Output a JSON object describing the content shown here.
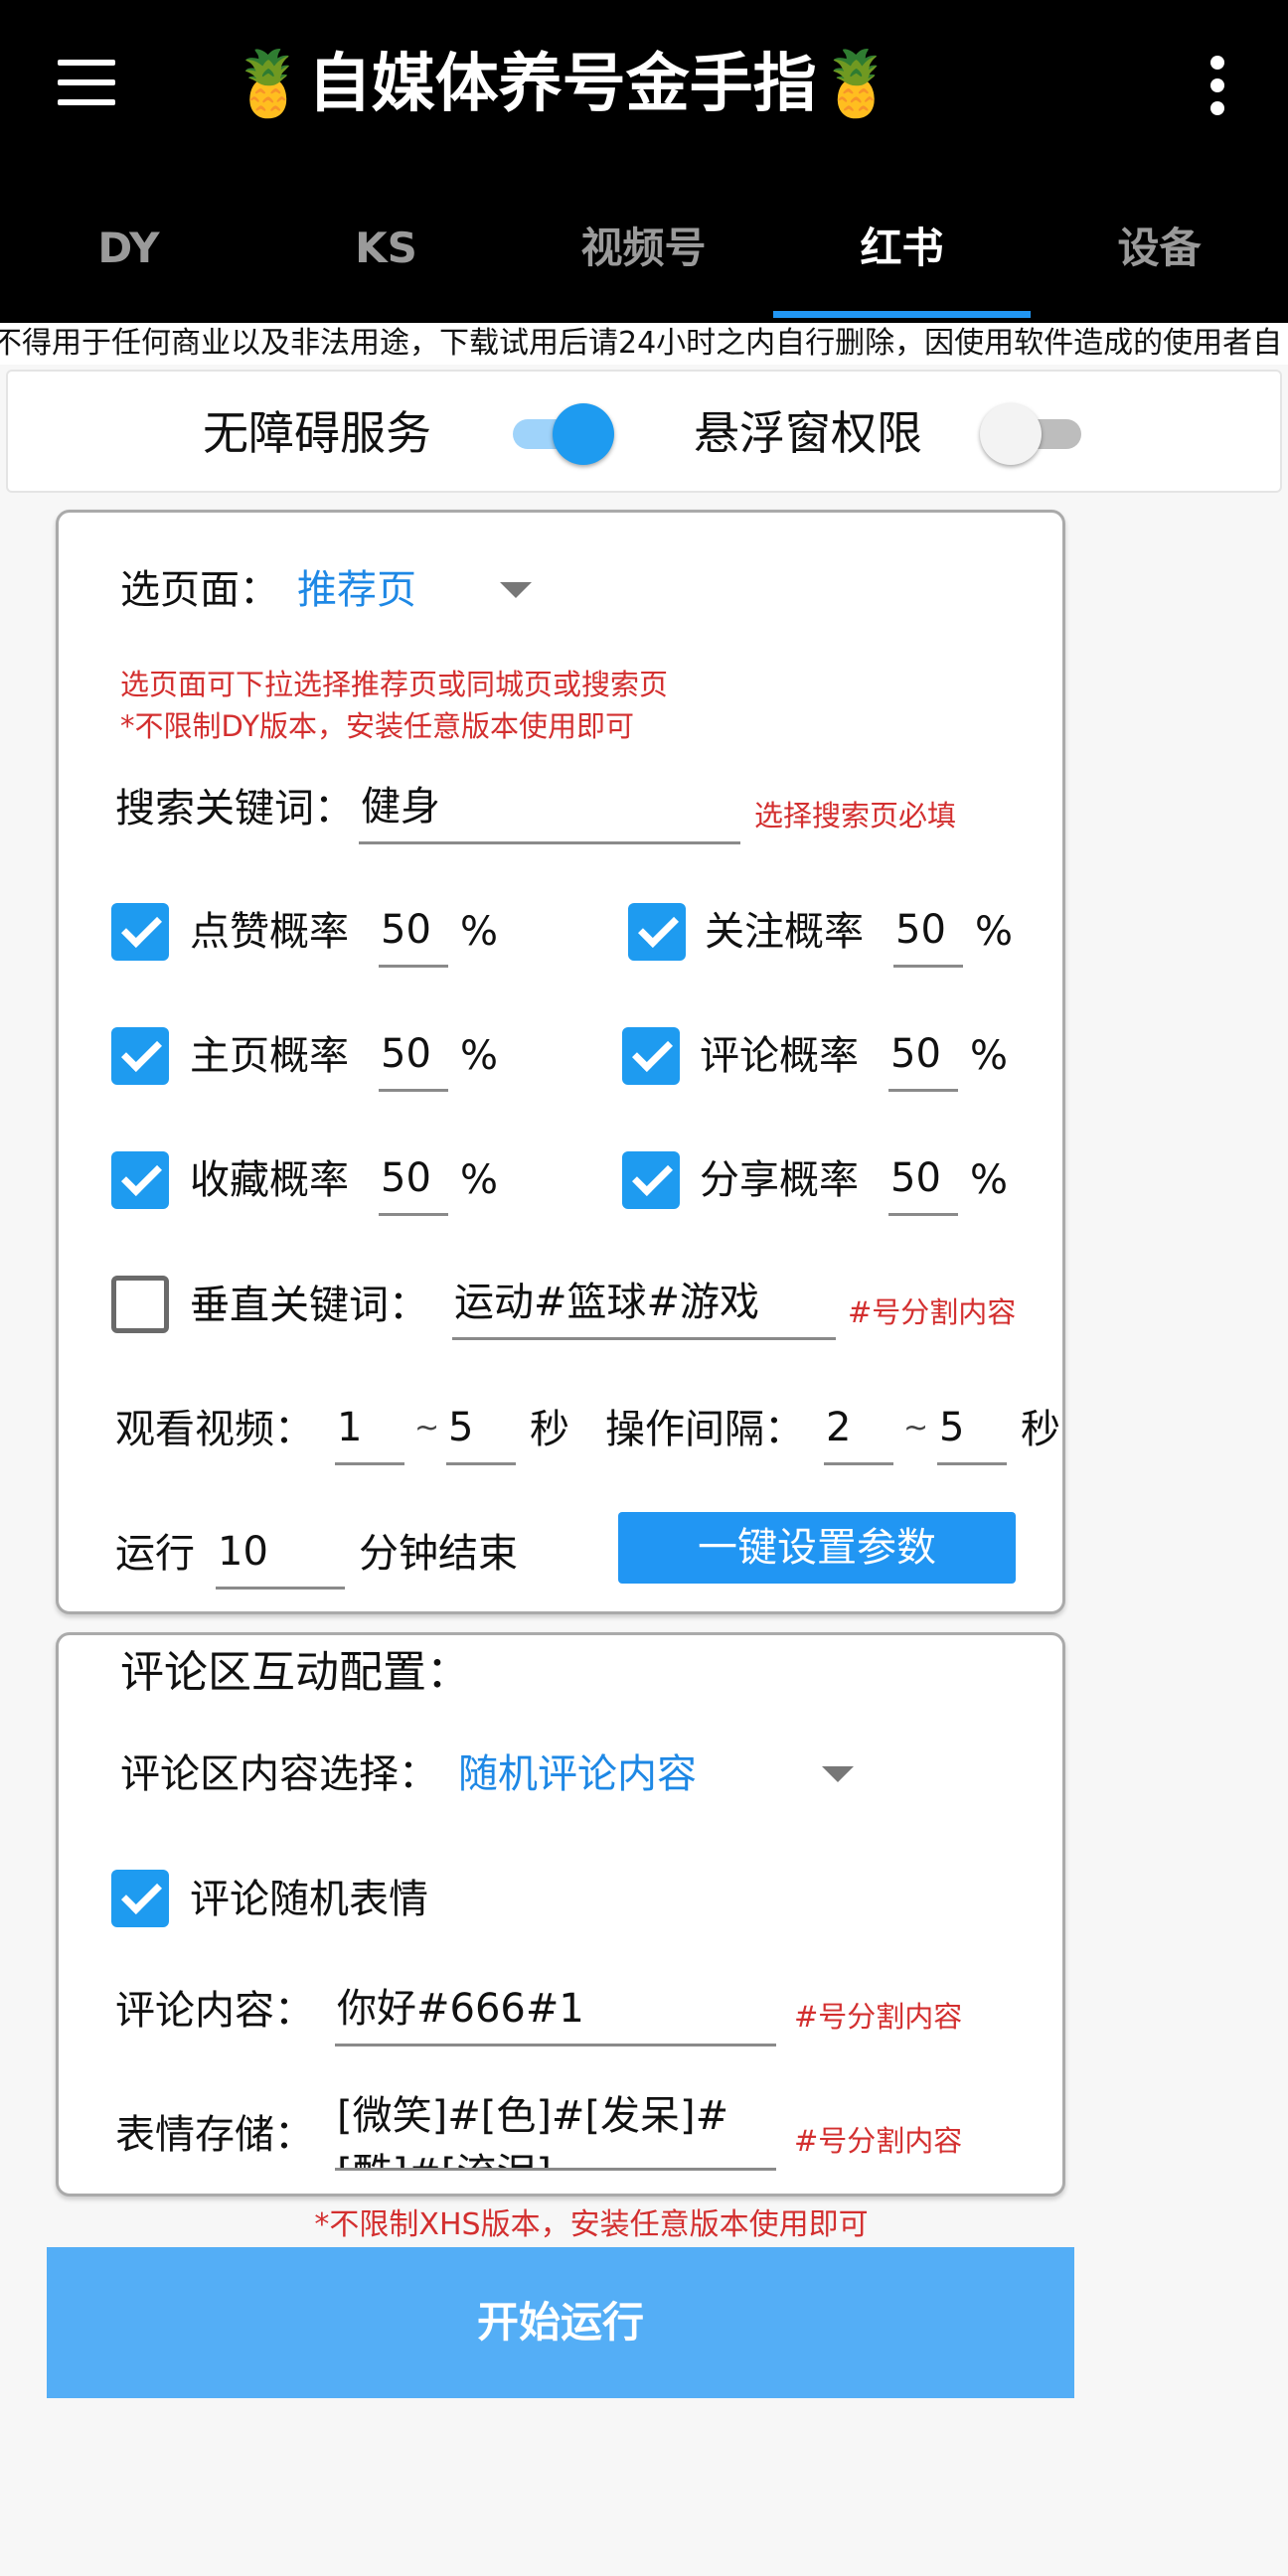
{
  "app": {
    "title": "🍍自媒体养号金手指🍍",
    "accent_color": "#2196f3",
    "menu_icon": "hamburger-menu-icon",
    "more_icon": "more-vertical-icon"
  },
  "tabs": [
    {
      "label": "DY",
      "active": false
    },
    {
      "label": "KS",
      "active": false
    },
    {
      "label": "视频号",
      "active": false
    },
    {
      "label": "红书",
      "active": true
    },
    {
      "label": "设备",
      "active": false
    }
  ],
  "disclaimer": "不得用于任何商业以及非法用途，下载试用后请24小时之内自行删除，因使用软件造成的使用者自",
  "permissions": {
    "accessibility_label": "无障碍服务",
    "accessibility_on": true,
    "overlay_label": "悬浮窗权限",
    "overlay_on": false
  },
  "config": {
    "page_label": "选页面：",
    "page_value": "推荐页",
    "page_hint_1": "选页面可下拉选择推荐页或同城页或搜索页",
    "page_hint_2": "*不限制DY版本，安装任意版本使用即可",
    "keyword_label": "搜索关键词：",
    "keyword_value": "健身",
    "keyword_hint": "选择搜索页必填",
    "percent_sign": "%",
    "rates": {
      "like": {
        "label": "点赞概率",
        "value": "50",
        "checked": true
      },
      "follow": {
        "label": "关注概率",
        "value": "50",
        "checked": true
      },
      "homepage": {
        "label": "主页概率",
        "value": "50",
        "checked": true
      },
      "comment": {
        "label": "评论概率",
        "value": "50",
        "checked": true
      },
      "favorite": {
        "label": "收藏概率",
        "value": "50",
        "checked": true
      },
      "share": {
        "label": "分享概率",
        "value": "50",
        "checked": true
      }
    },
    "vertical_keyword": {
      "label": "垂直关键词：",
      "value": "运动#篮球#游戏",
      "hint": "#号分割内容",
      "checked": false
    },
    "watch": {
      "label": "观看视频：",
      "min": "1",
      "max": "5",
      "unit": "秒",
      "sep": "~"
    },
    "interval": {
      "label": "操作间隔：",
      "min": "2",
      "max": "5",
      "unit": "秒",
      "sep": "~"
    },
    "run": {
      "prefix": "运行",
      "value": "10",
      "suffix": "分钟结束"
    },
    "one_key_button": "一键设置参数"
  },
  "comment_config": {
    "title": "评论区互动配置：",
    "content_select_label": "评论区内容选择：",
    "content_select_value": "随机评论内容",
    "random_emoji_label": "评论随机表情",
    "random_emoji_checked": true,
    "comment_content_label": "评论内容：",
    "comment_content_value": "你好#666#1",
    "comment_content_hint": "#号分割内容",
    "emoji_store_label": "表情存储：",
    "emoji_store_value": "[微笑]#[色]#[发呆]#[酷]#[流泪]",
    "emoji_store_hint": "#号分割内容"
  },
  "footer": {
    "note": "*不限制XHS版本，安装任意版本使用即可",
    "start_button": "开始运行"
  }
}
